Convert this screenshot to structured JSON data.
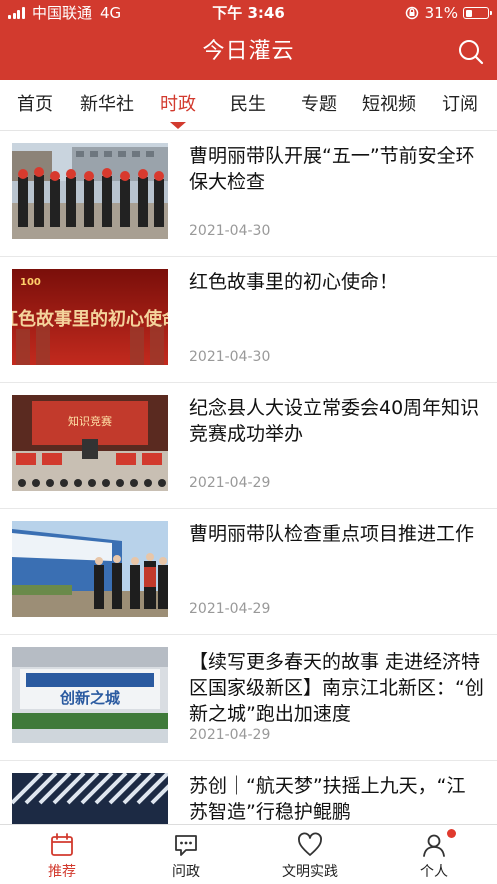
{
  "status_bar": {
    "carrier": "中国联通",
    "network": "4G",
    "time": "下午 3:46",
    "battery": "31%",
    "battery_level": 0.31
  },
  "header": {
    "title": "今日灌云",
    "search_icon": "search-icon",
    "color": "#d23a2e"
  },
  "tabs": [
    {
      "label": "首页"
    },
    {
      "label": "新华社"
    },
    {
      "label": "时政",
      "active": true
    },
    {
      "label": "民生"
    },
    {
      "label": "专题"
    },
    {
      "label": "短视频"
    },
    {
      "label": "订阅"
    }
  ],
  "news": [
    {
      "title": "曹明丽带队开展“五一”节前安全环保大检查",
      "date": "2021-04-30"
    },
    {
      "title": "红色故事里的初心使命！",
      "date": "2021-04-30",
      "thumb_text": "红色故事里的初心使命"
    },
    {
      "title": "纪念县人大设立常委会40周年知识竞赛成功举办",
      "date": "2021-04-29",
      "thumb_text": "知识竞赛"
    },
    {
      "title": "曹明丽带队检查重点项目推进工作",
      "date": "2021-04-29"
    },
    {
      "title": "【续写更多春天的故事 走进经济特区国家级新区】南京江北新区：“创新之城”跑出加速度",
      "date": "2021-04-29",
      "thumb_text": "创新之城"
    },
    {
      "title": "苏创｜“航天梦”扶摇上九天，“江苏智造”行稳护鲲鹏",
      "date": ""
    }
  ],
  "bottom_nav": [
    {
      "label": "推荐",
      "icon": "calendar-icon",
      "active": true
    },
    {
      "label": "问政",
      "icon": "chat-icon"
    },
    {
      "label": "文明实践",
      "icon": "heart-icon"
    },
    {
      "label": "个人",
      "icon": "person-icon",
      "badge": true
    }
  ]
}
